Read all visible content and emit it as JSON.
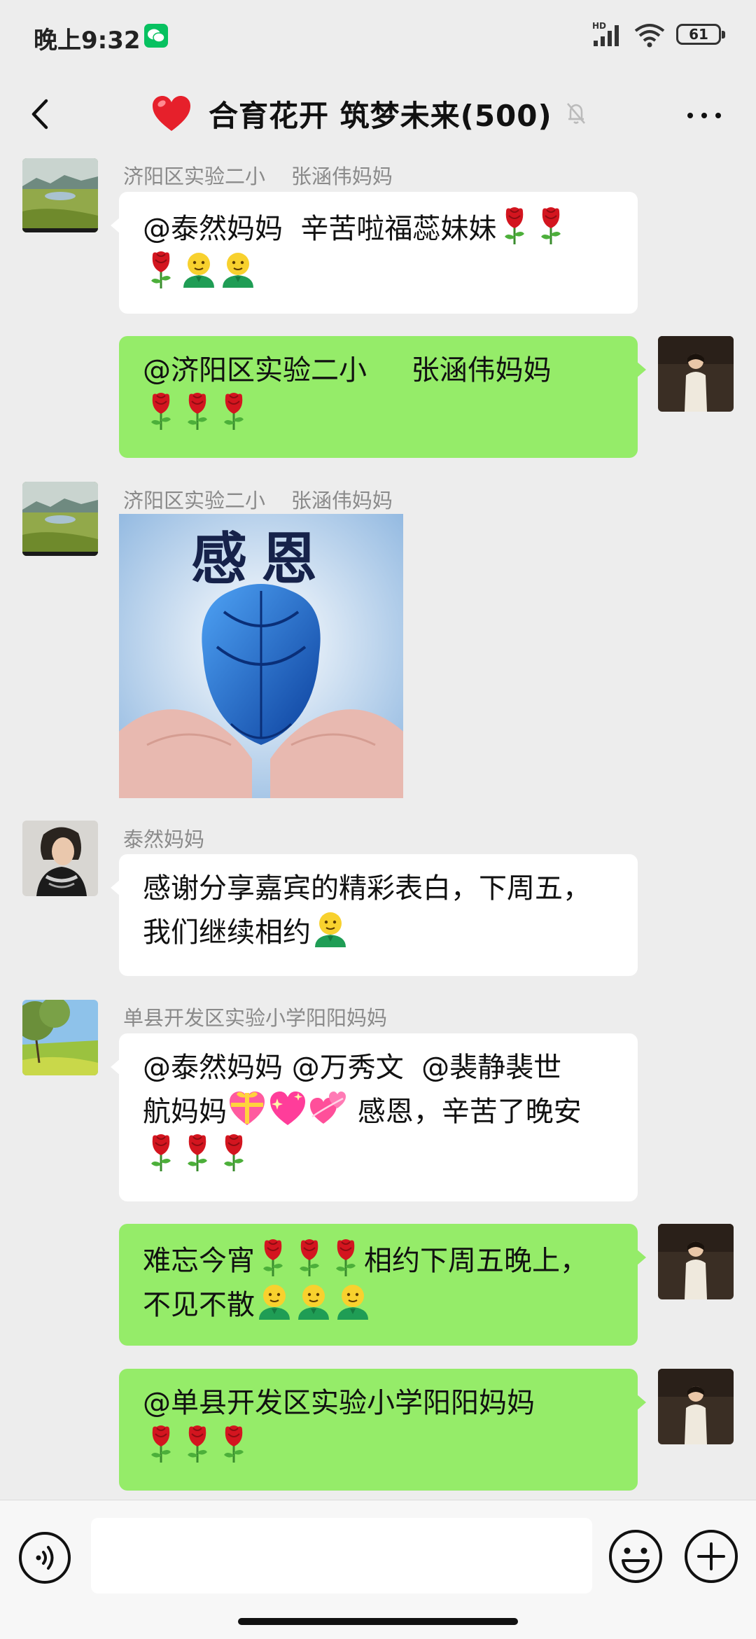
{
  "status_bar": {
    "time": "晚上9:32",
    "network_label": "HD",
    "battery": "61",
    "icons": [
      "wechat-icon",
      "signal-icon",
      "wifi-icon",
      "battery-icon"
    ]
  },
  "header": {
    "title": "合育花开 筑梦未来(500)",
    "icons": [
      "back-arrow-icon",
      "heart-icon",
      "mute-bell-icon",
      "more-dots-icon"
    ]
  },
  "messages": [
    {
      "direction": "incoming",
      "sender": "济阳区实验二小    张涵伟妈妈",
      "lines": [
        [
          "text:@泰然妈妈  辛苦啦福蕊妹妹",
          "rose",
          "rose"
        ],
        [
          "rose",
          "smiley",
          "smiley"
        ]
      ]
    },
    {
      "direction": "outgoing",
      "lines": [
        [
          "text:@济阳区实验二小     张涵伟妈妈"
        ],
        [
          "rose",
          "rose",
          "rose"
        ]
      ]
    },
    {
      "direction": "incoming",
      "sender": "济阳区实验二小    张涵伟妈妈",
      "sticker": {
        "caption": "感恩",
        "description": "hands holding blue rose"
      }
    },
    {
      "direction": "incoming",
      "sender": "泰然妈妈",
      "lines": [
        [
          "text:感谢分享嘉宾的精彩表白，下周五，"
        ],
        [
          "text:我们继续相约",
          "smiley"
        ]
      ]
    },
    {
      "direction": "incoming",
      "sender": "单县开发区实验小学阳阳妈妈",
      "lines": [
        [
          "text:@泰然妈妈 @万秀文  @裴静裴世"
        ],
        [
          "text:航妈妈",
          "gift-heart",
          "sparkle-heart",
          "two-hearts",
          "text: 感恩，辛苦了晚安"
        ],
        [
          "rose",
          "rose",
          "rose"
        ]
      ]
    },
    {
      "direction": "outgoing",
      "lines": [
        [
          "text:难忘今宵",
          "rose",
          "rose",
          "rose",
          "text:相约下周五晚上，"
        ],
        [
          "text:不见不散",
          "smiley",
          "smiley",
          "smiley"
        ]
      ]
    },
    {
      "direction": "outgoing",
      "lines": [
        [
          "text:@单县开发区实验小学阳阳妈妈"
        ],
        [
          "rose",
          "rose",
          "rose"
        ]
      ]
    }
  ],
  "input_bar": {
    "placeholder": "",
    "icons": [
      "voice-icon",
      "emoji-face-icon",
      "plus-icon"
    ]
  },
  "colors": {
    "background": "#ededed",
    "outgoing_bubble": "#95ec69",
    "incoming_bubble": "#ffffff",
    "sender_name": "#8a8a8a",
    "wechat_green": "#07c160"
  }
}
